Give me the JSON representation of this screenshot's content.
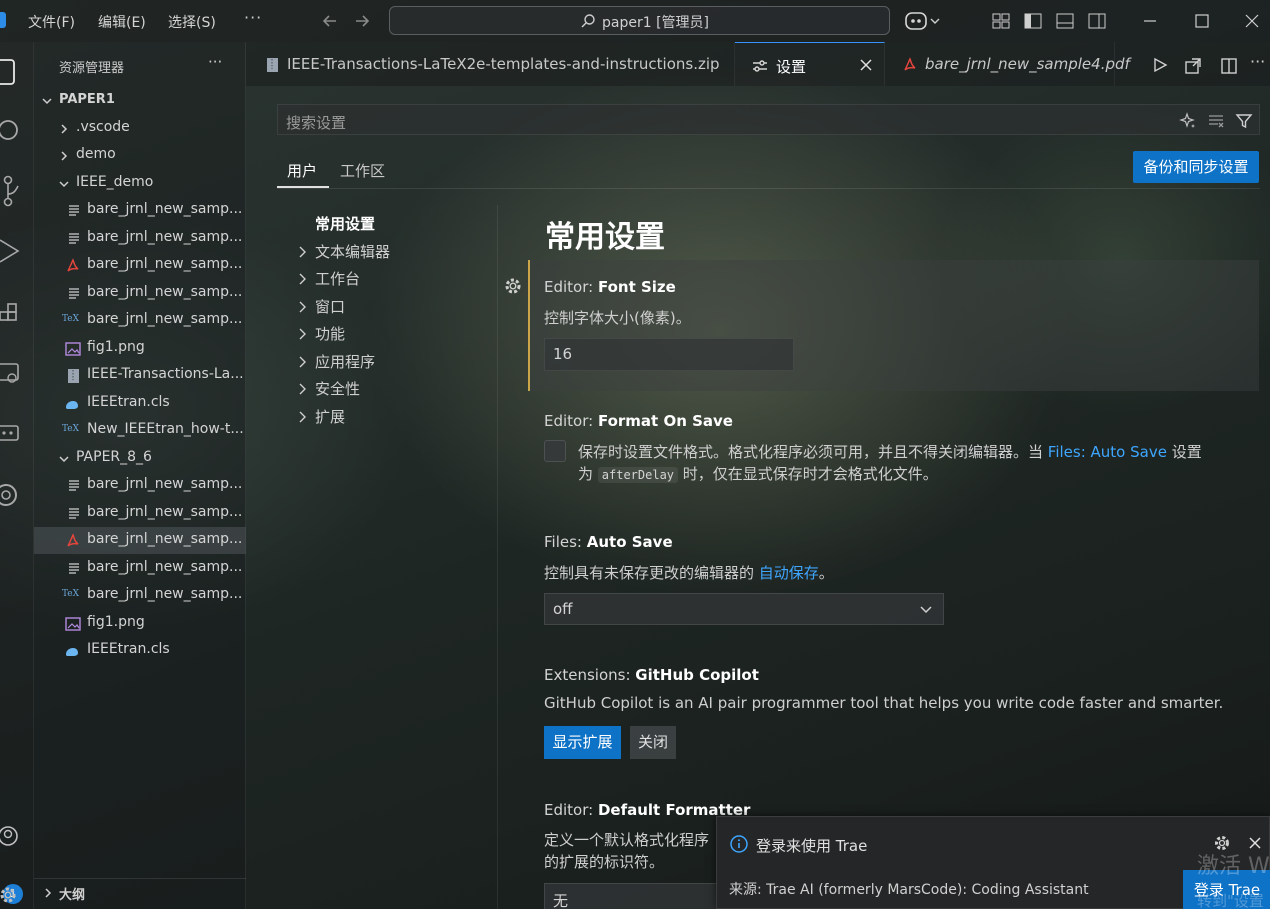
{
  "titlebar": {
    "menus": [
      "文件(F)",
      "编辑(E)",
      "选择(S)"
    ],
    "more": "···",
    "search_text": "paper1 [管理员]"
  },
  "sidebar": {
    "title": "资源管理器",
    "more": "···",
    "root": "PAPER1",
    "items": [
      {
        "label": ".vscode",
        "type": "folder-collapsed"
      },
      {
        "label": "demo",
        "type": "folder-collapsed"
      },
      {
        "label": "IEEE_demo",
        "type": "folder-open"
      },
      {
        "label": "bare_jrnl_new_samp...",
        "type": "file-text"
      },
      {
        "label": "bare_jrnl_new_samp...",
        "type": "file-text"
      },
      {
        "label": "bare_jrnl_new_samp...",
        "type": "file-pdf"
      },
      {
        "label": "bare_jrnl_new_samp...",
        "type": "file-text"
      },
      {
        "label": "bare_jrnl_new_samp...",
        "type": "file-tex"
      },
      {
        "label": "fig1.png",
        "type": "file-image"
      },
      {
        "label": "IEEE-Transactions-La...",
        "type": "file-zip"
      },
      {
        "label": "IEEEtran.cls",
        "type": "file-cls"
      },
      {
        "label": "New_IEEEtran_how-t...",
        "type": "file-tex"
      },
      {
        "label": "PAPER_8_6",
        "type": "folder-open"
      },
      {
        "label": "bare_jrnl_new_samp...",
        "type": "file-text"
      },
      {
        "label": "bare_jrnl_new_samp...",
        "type": "file-text"
      },
      {
        "label": "bare_jrnl_new_samp...",
        "type": "file-pdf"
      },
      {
        "label": "bare_jrnl_new_samp...",
        "type": "file-text"
      },
      {
        "label": "bare_jrnl_new_samp...",
        "type": "file-tex"
      },
      {
        "label": "fig1.png",
        "type": "file-image"
      },
      {
        "label": "IEEEtran.cls",
        "type": "file-cls"
      }
    ],
    "outline": "大纲",
    "account_badge": "1"
  },
  "tabs": [
    {
      "label": "IEEE-Transactions-LaTeX2e-templates-and-instructions.zip",
      "icon": "zip-icon"
    },
    {
      "label": "设置",
      "icon": "settings-icon",
      "active": true
    },
    {
      "label": "bare_jrnl_new_sample4.pdf",
      "icon": "pdf-icon"
    }
  ],
  "settings": {
    "search_placeholder": "搜索设置",
    "scope_tabs": [
      "用户",
      "工作区"
    ],
    "sync_button": "备份和同步设置",
    "toc_active": "常用设置",
    "toc": [
      "文本编辑器",
      "工作台",
      "窗口",
      "功能",
      "应用程序",
      "安全性",
      "扩展"
    ],
    "section_title": "常用设置",
    "font_size": {
      "category": "Editor: ",
      "name": "Font Size",
      "desc": "控制字体大小(像素)。",
      "value": "16"
    },
    "format_on_save": {
      "category": "Editor: ",
      "name": "Format On Save",
      "desc_part1": "保存时设置文件格式。格式化程序必须可用，并且不得关闭编辑器。当 ",
      "desc_link": "Files: Auto Save",
      "desc_part2": " 设置",
      "desc_line2_a": "为 ",
      "desc_code": "afterDelay",
      "desc_line2_b": " 时，仅在显式保存时才会格式化文件。"
    },
    "auto_save": {
      "category": "Files: ",
      "name": "Auto Save",
      "desc_part1": "控制具有未保存更改的编辑器的 ",
      "desc_link": "自动保存",
      "desc_part2": "。",
      "value": "off"
    },
    "copilot": {
      "category": "Extensions: ",
      "name": "GitHub Copilot",
      "desc": "GitHub Copilot is an AI pair programmer tool that helps you write code faster and smarter.",
      "show_button": "显示扩展",
      "close_button": "关闭"
    },
    "default_formatter": {
      "category": "Editor: ",
      "name": "Default Formatter",
      "desc_line1": "定义一个默认格式化程序",
      "desc_line2": "的扩展的标识符。",
      "value": "无"
    }
  },
  "notification": {
    "message": "登录来使用 Trae",
    "source": "来源: Trae AI (formerly MarsCode): Coding Assistant",
    "button": "登录 Trae"
  },
  "watermark": {
    "line1": "激活 W",
    "line2": "转到\"设置"
  }
}
